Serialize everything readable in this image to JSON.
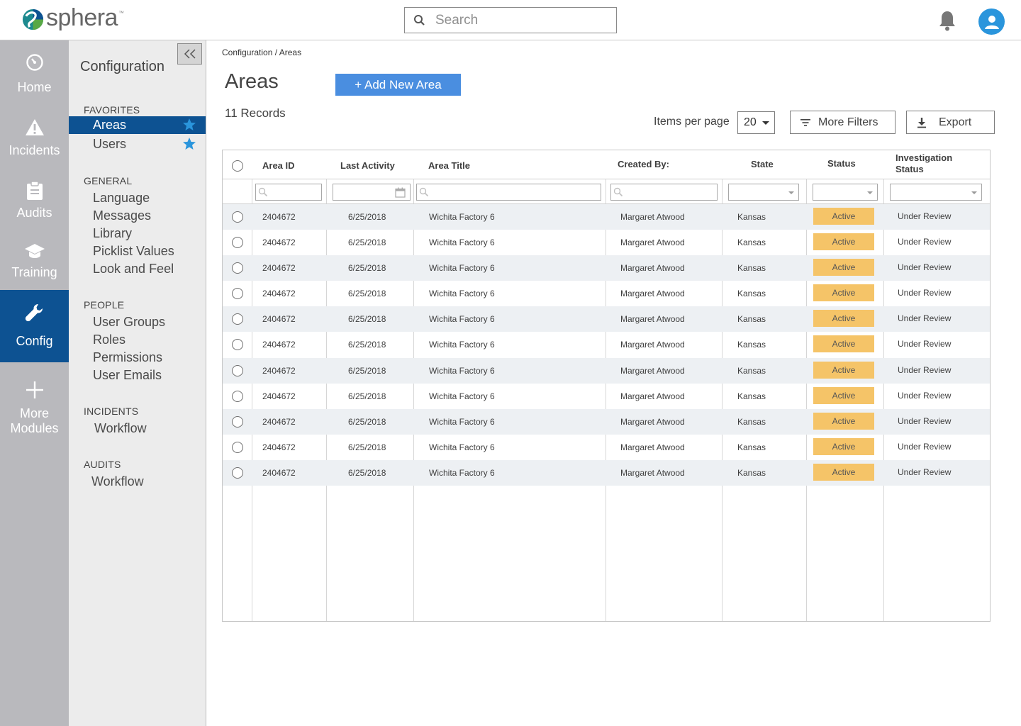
{
  "header": {
    "brand": "sphera",
    "brand_tm": "™",
    "search_placeholder": "Search"
  },
  "rail": {
    "items": [
      {
        "label": "Home",
        "icon": "home-dial-icon"
      },
      {
        "label": "Incidents",
        "icon": "warning-icon"
      },
      {
        "label": "Audits",
        "icon": "clipboard-icon"
      },
      {
        "label": "Training",
        "icon": "graduation-cap-icon"
      },
      {
        "label": "Config",
        "icon": "wrench-icon",
        "active": true
      },
      {
        "label_1": "More",
        "label_2": "Modules",
        "icon": "plus-icon"
      }
    ]
  },
  "subnav": {
    "title": "Configuration",
    "favorites": {
      "heading": "FAVORITES",
      "items": [
        "Areas",
        "Users"
      ]
    },
    "general": {
      "heading": "GENERAL",
      "items": [
        "Language",
        "Messages",
        "Library",
        "Picklist Values",
        "Look and Feel"
      ]
    },
    "people": {
      "heading": "PEOPLE",
      "items": [
        "User Groups",
        "Roles",
        "Permissions",
        "User Emails"
      ]
    },
    "incidents": {
      "heading": "INCIDENTS",
      "items": [
        "Workflow"
      ]
    },
    "audits": {
      "heading": "AUDITS",
      "items": [
        "Workflow"
      ]
    }
  },
  "main": {
    "breadcrumb": "Configuration / Areas",
    "title": "Areas",
    "add_button": "+ Add New Area",
    "records": "11 Records",
    "items_per_page_label": "Items per page",
    "items_per_page_value": "20",
    "more_filters": "More Filters",
    "export": "Export"
  },
  "table": {
    "columns": [
      "Area ID",
      "Last Activity",
      "Area Title",
      "Created By:",
      "State",
      "Status",
      "Investigation Status"
    ],
    "columns_inv_1": "Investigation",
    "columns_inv_2": "Status",
    "rows": [
      {
        "id": "2404672",
        "last": "6/25/2018",
        "title": "Wichita Factory 6",
        "by": "Margaret Atwood",
        "state": "Kansas",
        "status": "Active",
        "inv": "Under Review"
      },
      {
        "id": "2404672",
        "last": "6/25/2018",
        "title": "Wichita Factory 6",
        "by": "Margaret Atwood",
        "state": "Kansas",
        "status": "Active",
        "inv": "Under Review"
      },
      {
        "id": "2404672",
        "last": "6/25/2018",
        "title": "Wichita Factory 6",
        "by": "Margaret Atwood",
        "state": "Kansas",
        "status": "Active",
        "inv": "Under Review"
      },
      {
        "id": "2404672",
        "last": "6/25/2018",
        "title": "Wichita Factory 6",
        "by": "Margaret Atwood",
        "state": "Kansas",
        "status": "Active",
        "inv": "Under Review"
      },
      {
        "id": "2404672",
        "last": "6/25/2018",
        "title": "Wichita Factory 6",
        "by": "Margaret Atwood",
        "state": "Kansas",
        "status": "Active",
        "inv": "Under Review"
      },
      {
        "id": "2404672",
        "last": "6/25/2018",
        "title": "Wichita Factory 6",
        "by": "Margaret Atwood",
        "state": "Kansas",
        "status": "Active",
        "inv": "Under Review"
      },
      {
        "id": "2404672",
        "last": "6/25/2018",
        "title": "Wichita Factory 6",
        "by": "Margaret Atwood",
        "state": "Kansas",
        "status": "Active",
        "inv": "Under Review"
      },
      {
        "id": "2404672",
        "last": "6/25/2018",
        "title": "Wichita Factory 6",
        "by": "Margaret Atwood",
        "state": "Kansas",
        "status": "Active",
        "inv": "Under Review"
      },
      {
        "id": "2404672",
        "last": "6/25/2018",
        "title": "Wichita Factory 6",
        "by": "Margaret Atwood",
        "state": "Kansas",
        "status": "Active",
        "inv": "Under Review"
      },
      {
        "id": "2404672",
        "last": "6/25/2018",
        "title": "Wichita Factory 6",
        "by": "Margaret Atwood",
        "state": "Kansas",
        "status": "Active",
        "inv": "Under Review"
      },
      {
        "id": "2404672",
        "last": "6/25/2018",
        "title": "Wichita Factory 6",
        "by": "Margaret Atwood",
        "state": "Kansas",
        "status": "Active",
        "inv": "Under Review"
      }
    ]
  },
  "colors": {
    "rail_bg": "#b9b9bd",
    "active_nav": "#0d5292",
    "primary_button": "#4a8ee0",
    "status_active": "#f5c468",
    "star": "#2a95dc"
  }
}
